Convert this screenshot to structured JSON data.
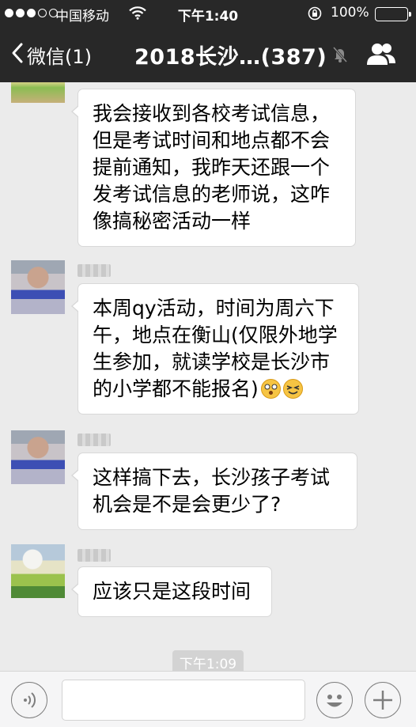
{
  "status_bar": {
    "carrier": "中国移动",
    "time": "下午1:40",
    "battery": "100%",
    "signal_bars_on": 3,
    "signal_bars_total": 5,
    "battery_level": 1.0
  },
  "nav": {
    "back_label": "微信(1)",
    "title": "2018长沙…(387)"
  },
  "messages": [
    {
      "sender": "",
      "text": "我会接收到各校考试信息，但是考试时间和地点都不会提前通知，我昨天还跟一个发考试信息的老师说，这咋像搞秘密活动一样"
    },
    {
      "sender": "",
      "text": "本周qy活动，时间为周六下午，地点在衡山(仅限外地学生参加，就读学校是长沙市的小学都不能报名)",
      "emojis": [
        "dizzy-face-emoji",
        "squint-face-emoji"
      ]
    },
    {
      "sender": "",
      "text": "这样搞下去，长沙孩子考试机会是不是会更少了?"
    },
    {
      "sender": "",
      "text": "应该只是这段时间"
    }
  ],
  "time_divider": "下午1:09",
  "input": {
    "placeholder": "",
    "value": ""
  },
  "icons": {
    "back": "chevron-left-icon",
    "mute": "bell-muted-icon",
    "members": "group-members-icon",
    "voice": "voice-icon",
    "emoji": "emoji-icon",
    "plus": "plus-icon"
  },
  "colors": {
    "nav_background": "#282828",
    "chat_background": "#ebebeb",
    "bubble": "#ffffff"
  }
}
